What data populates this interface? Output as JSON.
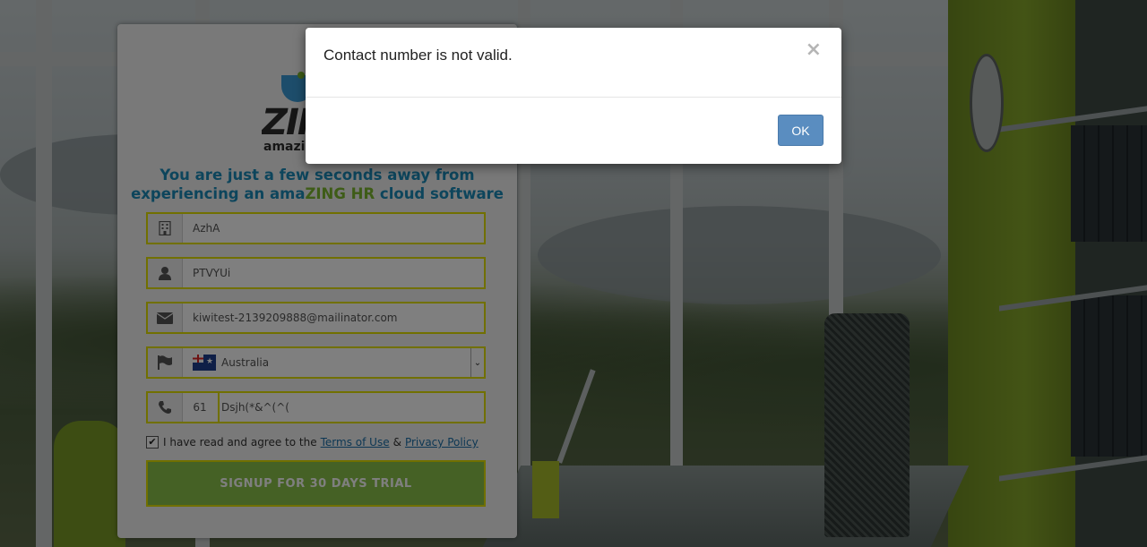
{
  "modal": {
    "message": "Contact number is not valid.",
    "close_glyph": "×",
    "ok_label": "OK"
  },
  "brand": {
    "logo_text": "ZING",
    "logo_tagline": "amazin",
    "headline_part1": "You are just a few seconds away from",
    "headline_part2a": "experiencing an ama",
    "headline_highlight": "ZING HR",
    "headline_part2b": " cloud software",
    "accent_blue": "#1a8ab8",
    "accent_green": "#7cb82f"
  },
  "form": {
    "company": {
      "value": "AzhA",
      "icon": "building-icon"
    },
    "name": {
      "value": "PTVYUi",
      "icon": "user-icon"
    },
    "email": {
      "value": "kiwitest-2139209888@mailinator.com",
      "icon": "envelope-icon"
    },
    "country": {
      "value": "Australia",
      "icon": "flag-icon"
    },
    "phone": {
      "code": "61",
      "value": "Dsjh(*&^(^(",
      "icon": "phone-icon"
    },
    "agree_text": "I have read and agree to the",
    "terms_label": "Terms of Use",
    "ampersand": "&",
    "privacy_label": "Privacy Policy",
    "submit_label": "SIGNUP FOR 30 DAYS TRIAL"
  }
}
